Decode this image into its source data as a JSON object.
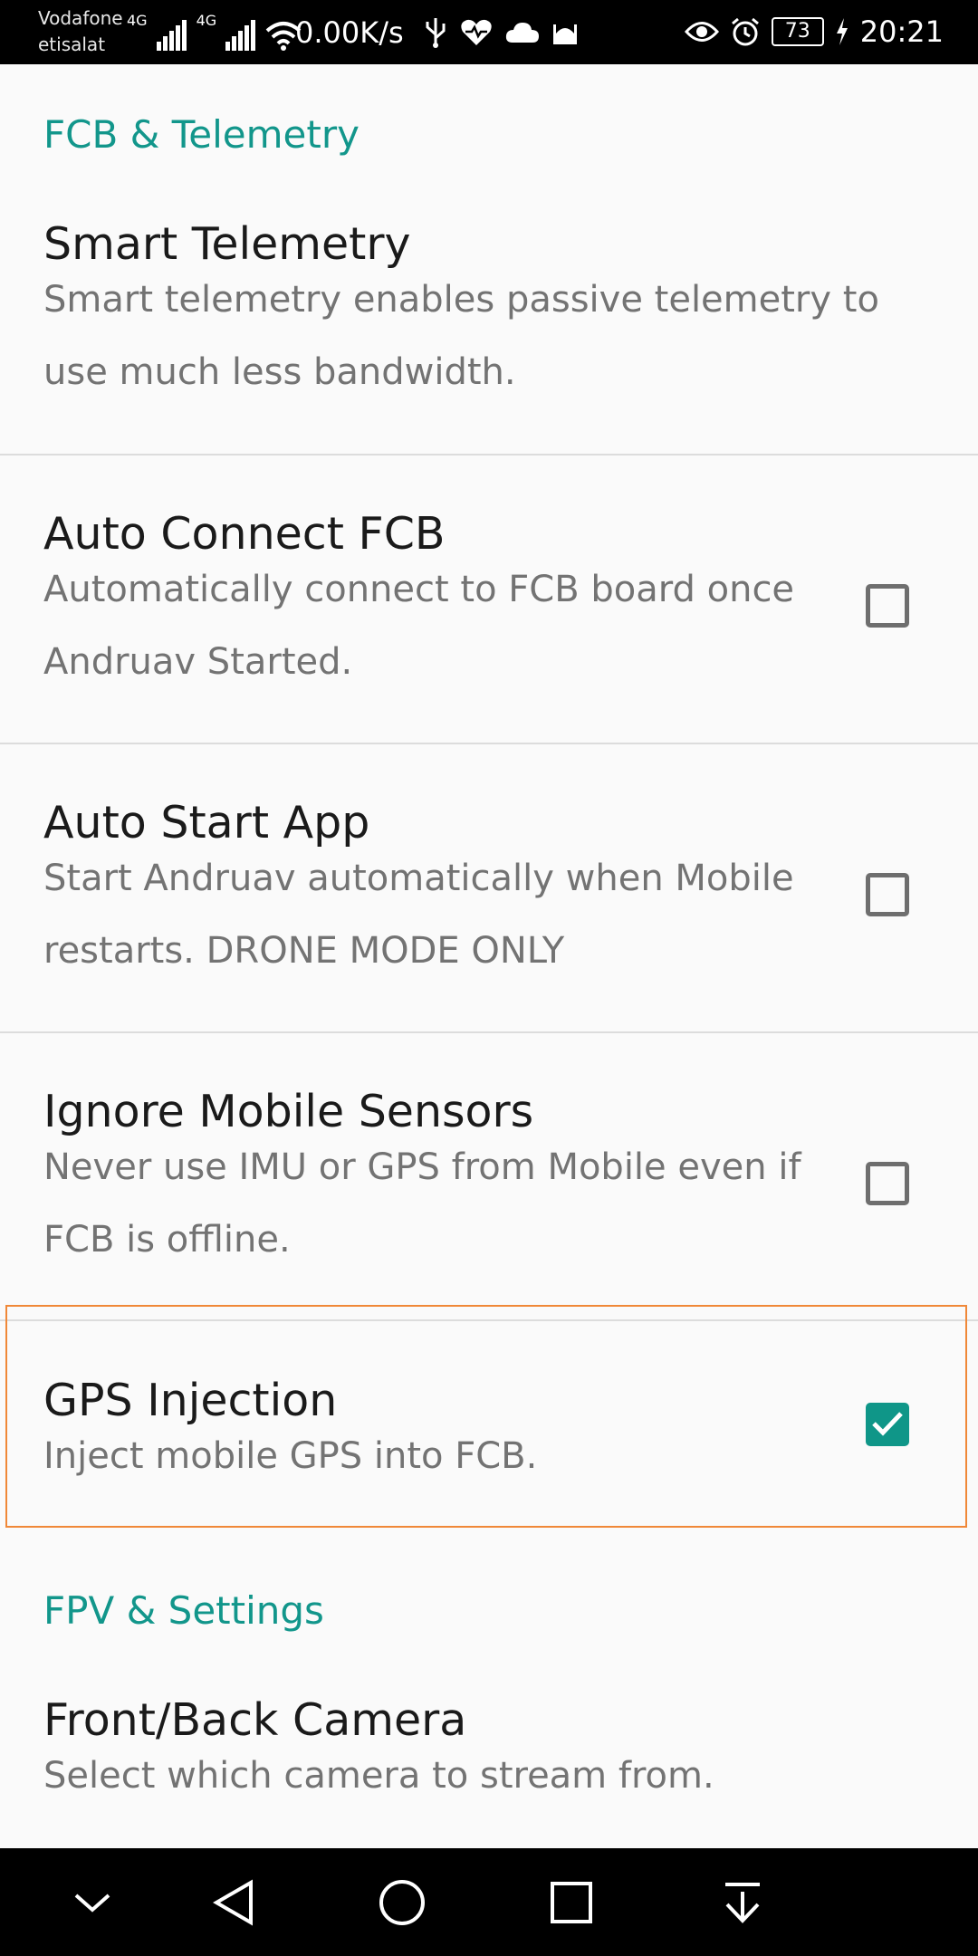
{
  "status_bar": {
    "carrier_1": "Vodafone",
    "carrier_2": "etisalat",
    "net_1": "4G",
    "net_2": "4G",
    "speed": "0.00K/s",
    "battery": "73",
    "time": "20:21"
  },
  "sections": {
    "fcb": {
      "title": "FCB & Telemetry",
      "items": [
        {
          "title": "Smart Telemetry",
          "summary": "Smart telemetry enables passive telemetry to use much less bandwidth."
        },
        {
          "title": "Auto Connect FCB",
          "summary": "Automatically connect to FCB board once Andruav Started.",
          "checked": false
        },
        {
          "title": "Auto Start App",
          "summary": "Start Andruav automatically when Mobile restarts. DRONE MODE ONLY",
          "checked": false
        },
        {
          "title": "Ignore Mobile Sensors",
          "summary": "Never use IMU or GPS from Mobile even if FCB is offline.",
          "checked": false
        },
        {
          "title": "GPS Injection",
          "summary": "Inject mobile GPS into FCB.",
          "checked": true
        }
      ]
    },
    "fpv": {
      "title": "FPV & Settings",
      "items": [
        {
          "title": "Front/Back Camera",
          "summary": "Select which camera to stream from."
        }
      ]
    }
  },
  "colors": {
    "accent": "#12968b",
    "checkbox_checked": "#0f9688",
    "highlight": "#f08838"
  }
}
